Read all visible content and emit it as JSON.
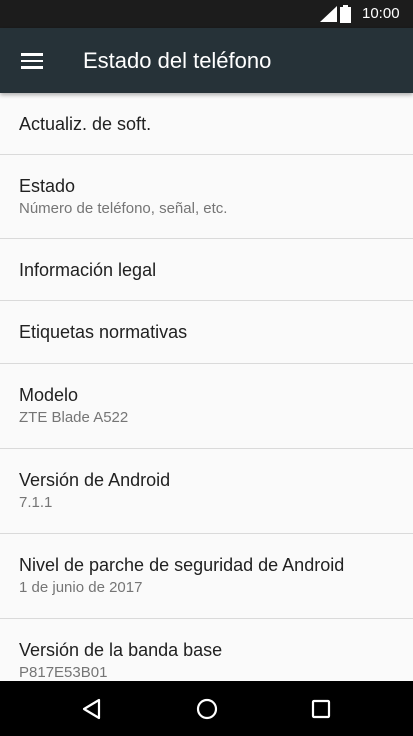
{
  "status_bar": {
    "time": "10:00",
    "icons": [
      "cell-signal-icon",
      "battery-icon"
    ],
    "background": "#1c1c1c"
  },
  "app_bar": {
    "title": "Estado del teléfono",
    "menu_icon": "hamburger-menu-icon",
    "background": "#263238"
  },
  "settings": {
    "items": [
      {
        "title": "Actualiz. de soft.",
        "summary": ""
      },
      {
        "title": "Estado",
        "summary": "Número de teléfono, señal, etc."
      },
      {
        "title": "Información legal",
        "summary": ""
      },
      {
        "title": "Etiquetas normativas",
        "summary": ""
      },
      {
        "title": "Modelo",
        "summary": "ZTE Blade A522"
      },
      {
        "title": "Versión de Android",
        "summary": "7.1.1"
      },
      {
        "title": "Nivel de parche de seguridad de Android",
        "summary": "1 de junio de 2017"
      },
      {
        "title": "Versión de la banda base",
        "summary": "P817E53B01"
      }
    ]
  },
  "nav_bar": {
    "buttons": [
      "back-icon",
      "home-icon",
      "recents-icon"
    ]
  }
}
